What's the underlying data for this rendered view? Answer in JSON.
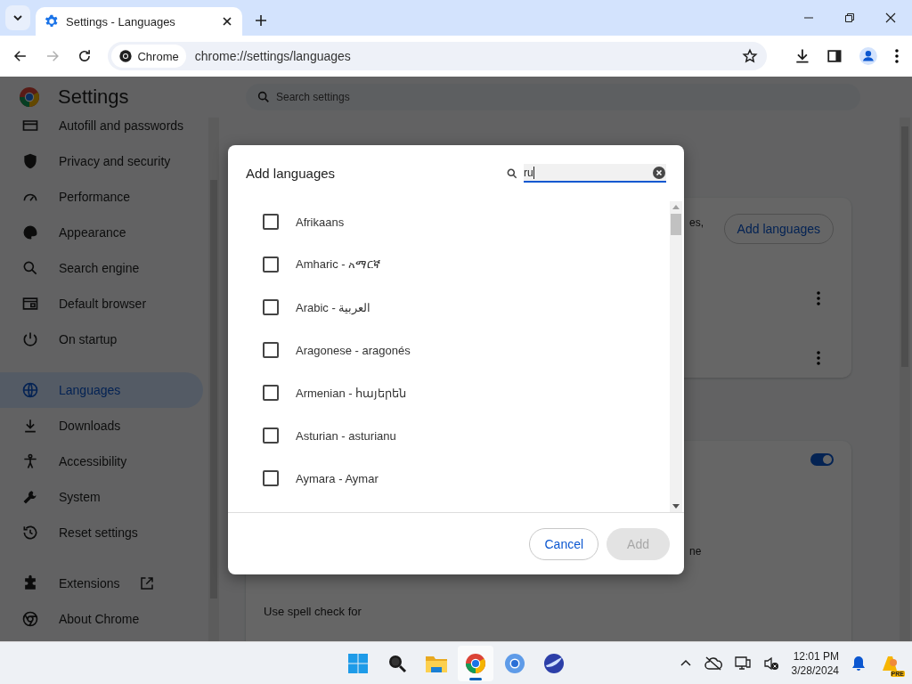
{
  "browser": {
    "tab": {
      "title": "Settings - Languages"
    },
    "chip": "Chrome",
    "url": "chrome://settings/languages"
  },
  "settings": {
    "title": "Settings",
    "search_placeholder": "Search settings",
    "nav_groups": [
      [
        {
          "label": "Autofill and passwords",
          "selected": false,
          "external": false
        },
        {
          "label": "Privacy and security",
          "selected": false,
          "external": false
        },
        {
          "label": "Performance",
          "selected": false,
          "external": false
        },
        {
          "label": "Appearance",
          "selected": false,
          "external": false
        },
        {
          "label": "Search engine",
          "selected": false,
          "external": false
        },
        {
          "label": "Default browser",
          "selected": false,
          "external": false
        },
        {
          "label": "On startup",
          "selected": false,
          "external": false
        }
      ],
      [
        {
          "label": "Languages",
          "selected": true,
          "external": false
        },
        {
          "label": "Downloads",
          "selected": false,
          "external": false
        },
        {
          "label": "Accessibility",
          "selected": false,
          "external": false
        },
        {
          "label": "System",
          "selected": false,
          "external": false
        },
        {
          "label": "Reset settings",
          "selected": false,
          "external": false
        }
      ],
      [
        {
          "label": "Extensions",
          "selected": false,
          "external": true
        },
        {
          "label": "About Chrome",
          "selected": false,
          "external": false
        }
      ]
    ],
    "card_1": {
      "fragment": "es,",
      "button": "Add languages"
    },
    "card_2": {
      "toggle": {
        "on": true
      },
      "fragment": "ne",
      "spell_check_label": "Use spell check for"
    }
  },
  "dialog": {
    "title": "Add languages",
    "search": {
      "value": "ru"
    },
    "languages": [
      {
        "name": "Afrikaans",
        "checked": false
      },
      {
        "name": "Amharic - አማርኛ",
        "checked": false
      },
      {
        "name": "Arabic - العربية",
        "checked": false
      },
      {
        "name": "Aragonese - aragonés",
        "checked": false
      },
      {
        "name": "Armenian - հայերեն",
        "checked": false
      },
      {
        "name": "Asturian - asturianu",
        "checked": false
      },
      {
        "name": "Aymara - Aymar",
        "checked": false
      }
    ],
    "buttons": [
      {
        "label": "Cancel",
        "disabled": false
      },
      {
        "label": "Add",
        "disabled": true
      }
    ]
  },
  "taskbar": {
    "apps": [
      {
        "selected": false
      },
      {
        "selected": false
      },
      {
        "selected": false
      },
      {
        "selected": true
      },
      {
        "selected": false
      },
      {
        "selected": false
      }
    ],
    "time": "12:01 PM",
    "date": "3/28/2024",
    "badge": "PRE"
  }
}
